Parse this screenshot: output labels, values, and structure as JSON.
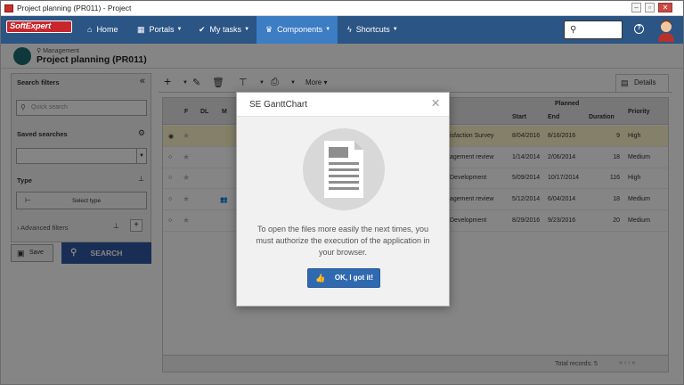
{
  "window": {
    "title": "Project planning (PR011) - Project"
  },
  "nav": {
    "logo": "SoftExpert",
    "items": [
      {
        "label": "Home",
        "icon": "home-icon"
      },
      {
        "label": "Portals",
        "icon": "portals-icon"
      },
      {
        "label": "My tasks",
        "icon": "check-icon"
      },
      {
        "label": "Components",
        "icon": "trophy-icon"
      },
      {
        "label": "Shortcuts",
        "icon": "lightning-icon"
      }
    ],
    "active_item": "Components"
  },
  "header": {
    "breadcrumb": "Management",
    "title": "Project planning (PR011)"
  },
  "sidebar": {
    "search_filters": "Search filters",
    "quick_search_placeholder": "Quick search",
    "saved_searches": "Saved searches",
    "type_label": "Type",
    "select_type": "Select type",
    "advanced_filters": "Advanced filters",
    "save": "Save",
    "search": "SEARCH"
  },
  "toolbar": {
    "more": "More",
    "details_tab": "Details"
  },
  "grid": {
    "columns": {
      "f": "F",
      "dl": "DL",
      "m": "M",
      "planned": "Planned",
      "start": "Start",
      "end": "End",
      "duration": "Duration",
      "priority": "Priority"
    },
    "rows": [
      {
        "name": "isfaction Survey",
        "start": "8/04/2016",
        "end": "8/16/2016",
        "duration": "9",
        "priority": "High",
        "selected": true
      },
      {
        "name": "agement review",
        "start": "1/14/2014",
        "end": "2/06/2014",
        "duration": "18",
        "priority": "Medium"
      },
      {
        "name": "Development",
        "start": "5/09/2014",
        "end": "10/17/2014",
        "duration": "116",
        "priority": "High"
      },
      {
        "name": "agement review",
        "start": "5/12/2014",
        "end": "6/04/2014",
        "duration": "18",
        "priority": "Medium"
      },
      {
        "name": "Development",
        "start": "8/29/2016",
        "end": "9/23/2016",
        "duration": "20",
        "priority": "Medium"
      }
    ],
    "total": "Total records: 5"
  },
  "dialog": {
    "title": "SE GanttChart",
    "message": "To open the files more easily the next times, you must authorize the execution of the application in your browser.",
    "ok_label": "OK, I got it!"
  },
  "colors": {
    "nav": "#2a5585",
    "nav_active": "#3c7dc4",
    "primary_button": "#2f58a4",
    "dialog_ok": "#2f6ab0",
    "selected_row": "#fdf6c9"
  }
}
